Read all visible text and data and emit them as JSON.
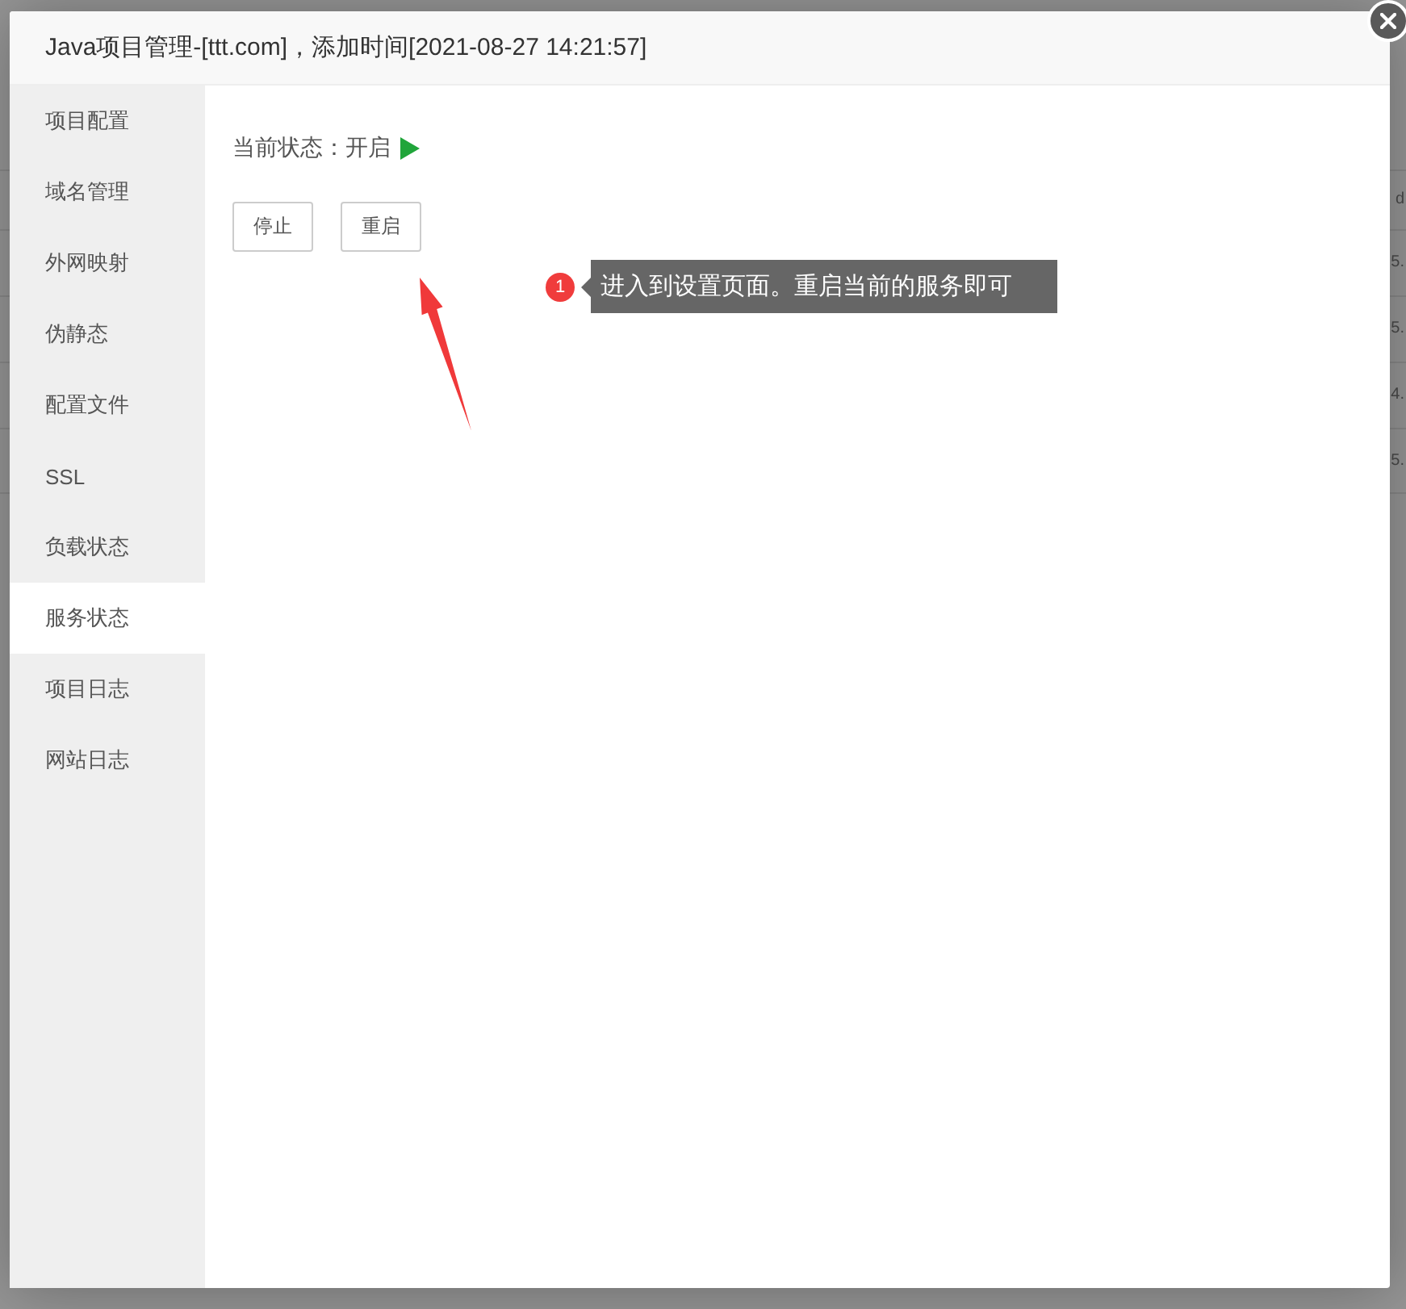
{
  "background_table": {
    "header": "d",
    "rows": [
      "5.",
      "5.",
      "4.",
      "5."
    ]
  },
  "dialog": {
    "title": "Java项目管理-[ttt.com]，添加时间[2021-08-27 14:21:57]"
  },
  "sidebar": {
    "items": [
      {
        "label": "项目配置",
        "selected": false
      },
      {
        "label": "域名管理",
        "selected": false
      },
      {
        "label": "外网映射",
        "selected": false
      },
      {
        "label": "伪静态",
        "selected": false
      },
      {
        "label": "配置文件",
        "selected": false
      },
      {
        "label": "SSL",
        "selected": false
      },
      {
        "label": "负载状态",
        "selected": false
      },
      {
        "label": "服务状态",
        "selected": true
      },
      {
        "label": "项目日志",
        "selected": false
      },
      {
        "label": "网站日志",
        "selected": false
      }
    ]
  },
  "service_status": {
    "label": "当前状态：",
    "value": "开启",
    "running": true
  },
  "buttons": [
    "停止",
    "重启"
  ],
  "annotation": {
    "step": "1",
    "text": "进入到设置页面。重启当前的服务即可"
  }
}
